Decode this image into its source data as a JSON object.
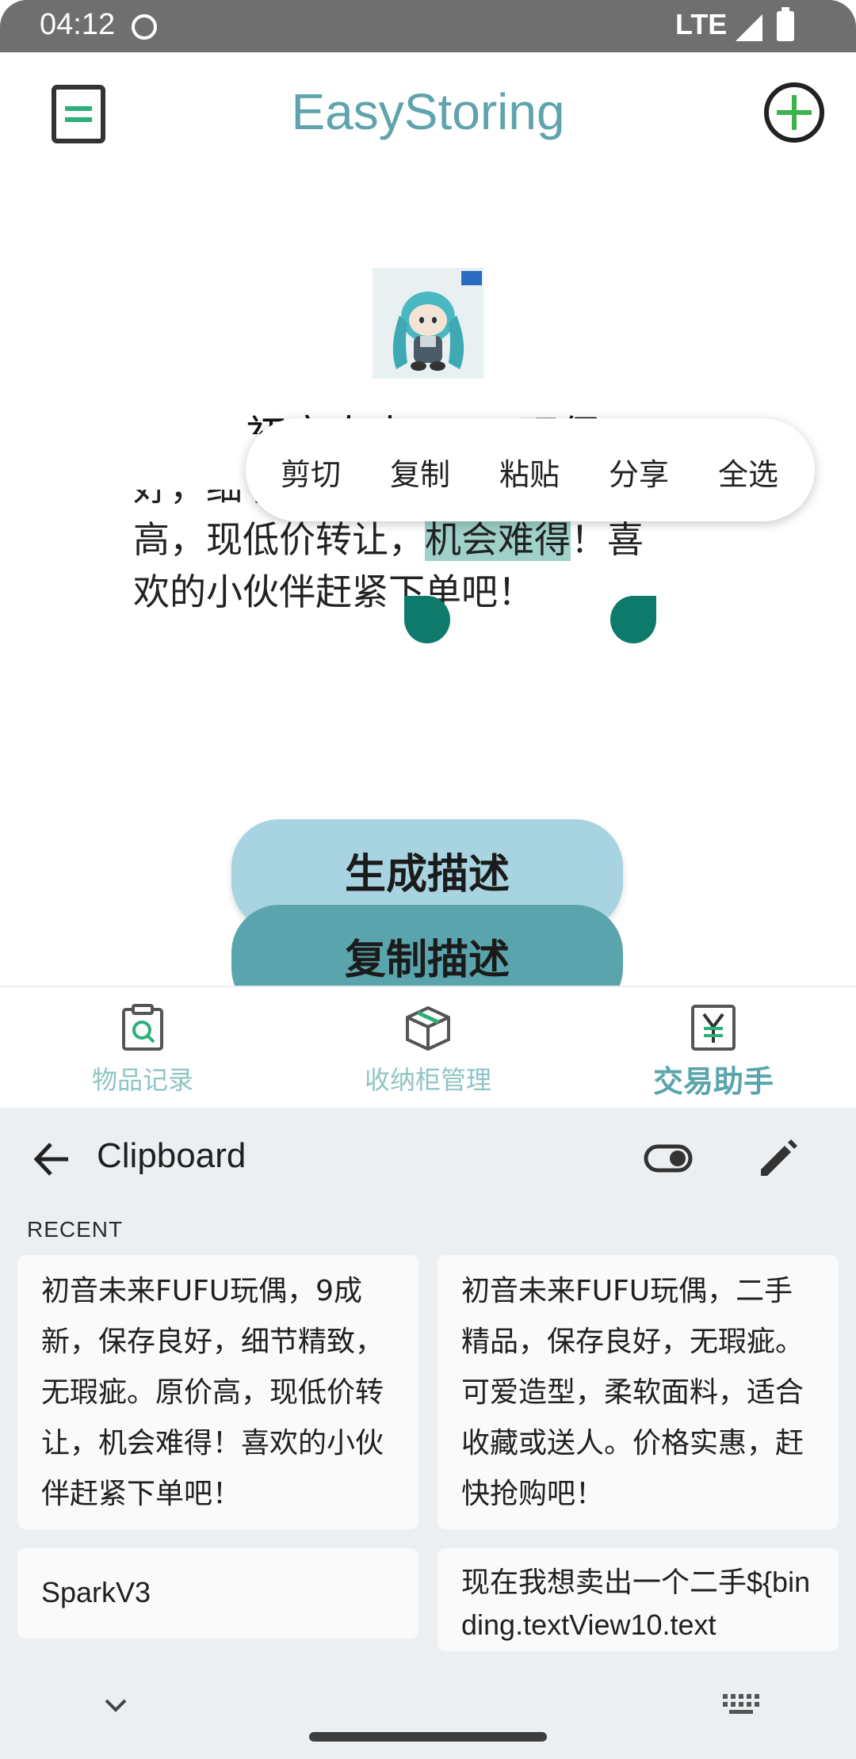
{
  "status_bar": {
    "time": "04:12",
    "network": "LTE"
  },
  "app_bar": {
    "title": "EasyStoring",
    "menu_icon": "document-icon",
    "add_icon": "add-circle-icon"
  },
  "item": {
    "title": "初音未来FUFU玩偶",
    "desc_line1": "好，细节精致，无瑕疵。原价",
    "desc_line2_before": "高，现低价转让，",
    "desc_line2_selected": "机会难得",
    "desc_line2_after": "！喜",
    "desc_line3": "欢的小伙伴赶紧下单吧！"
  },
  "selection_menu": [
    "剪切",
    "复制",
    "粘贴",
    "分享",
    "全选"
  ],
  "buttons": {
    "generate": "生成描述",
    "copy": "复制描述"
  },
  "bottom_nav": [
    {
      "label": "物品记录",
      "icon": "clipboard-search-icon",
      "active": false
    },
    {
      "label": "收纳柜管理",
      "icon": "box-icon",
      "active": false
    },
    {
      "label": "交易助手",
      "icon": "yen-icon",
      "active": true
    }
  ],
  "clipboard": {
    "title": "Clipboard",
    "section": "RECENT",
    "items": [
      "初音未来FUFU玩偶，9成新，保存良好，细节精致，无瑕疵。原价高，现低价转让，机会难得！喜欢的小伙伴赶紧下单吧！",
      "初音未来FUFU玩偶，二手精品，保存良好，无瑕疵。可爱造型，柔软面料，适合收藏或送人。价格实惠，赶快抢购吧！",
      "SparkV3",
      "现在我想卖出一个二手${binding.textView10.text"
    ]
  },
  "colors": {
    "accent": "#5aa5ad",
    "selection": "#9fd1c9",
    "handle": "#0e7a6b",
    "generate_btn": "#a8d3e1",
    "add_green": "#3bb34a"
  }
}
